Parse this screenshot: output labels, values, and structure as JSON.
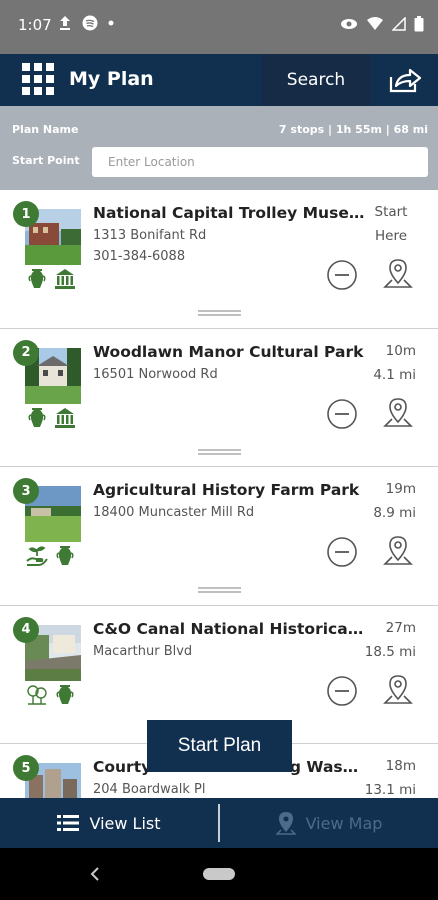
{
  "status_bar": {
    "time": "1:07"
  },
  "header": {
    "title": "My Plan",
    "search_label": "Search"
  },
  "plan": {
    "name_label": "Plan Name",
    "stats": "7 stops | 1h 55m | 68 mi",
    "start_point_label": "Start Point",
    "location_placeholder": "Enter Location",
    "location_value": ""
  },
  "stops": [
    {
      "number": "1",
      "name": "National Capital Trolley Muse...",
      "address": "1313 Bonifant Rd",
      "phone": "301-384-6088",
      "time": "Start",
      "distance": "Here",
      "icons": [
        "vase-icon",
        "museum-icon"
      ]
    },
    {
      "number": "2",
      "name": "Woodlawn Manor Cultural Park",
      "address": "16501 Norwood Rd",
      "phone": "",
      "time": "10m",
      "distance": "4.1 mi",
      "icons": [
        "vase-icon",
        "museum-icon"
      ]
    },
    {
      "number": "3",
      "name": "Agricultural History Farm Park",
      "address": "18400 Muncaster Mill Rd",
      "phone": "",
      "time": "19m",
      "distance": "8.9 mi",
      "icons": [
        "sprout-hand-icon",
        "vase-icon"
      ]
    },
    {
      "number": "4",
      "name": "C&O Canal National Historical...",
      "address": "Macarthur Blvd",
      "phone": "",
      "time": "27m",
      "distance": "18.5 mi",
      "icons": [
        "trees-icon",
        "vase-icon"
      ]
    },
    {
      "number": "5",
      "name": "Courtyard Gaithersburg Wash...",
      "address": "204 Boardwalk Pl",
      "phone": "",
      "time": "18m",
      "distance": "13.1 mi",
      "icons": []
    }
  ],
  "start_plan_label": "Start Plan",
  "bottom_bar": {
    "view_list_label": "View List",
    "view_map_label": "View Map"
  },
  "colors": {
    "header_bg": "#11304f",
    "status_bg": "#757575",
    "plan_bg": "#aab1b8",
    "accent_green": "#3f7a34"
  }
}
